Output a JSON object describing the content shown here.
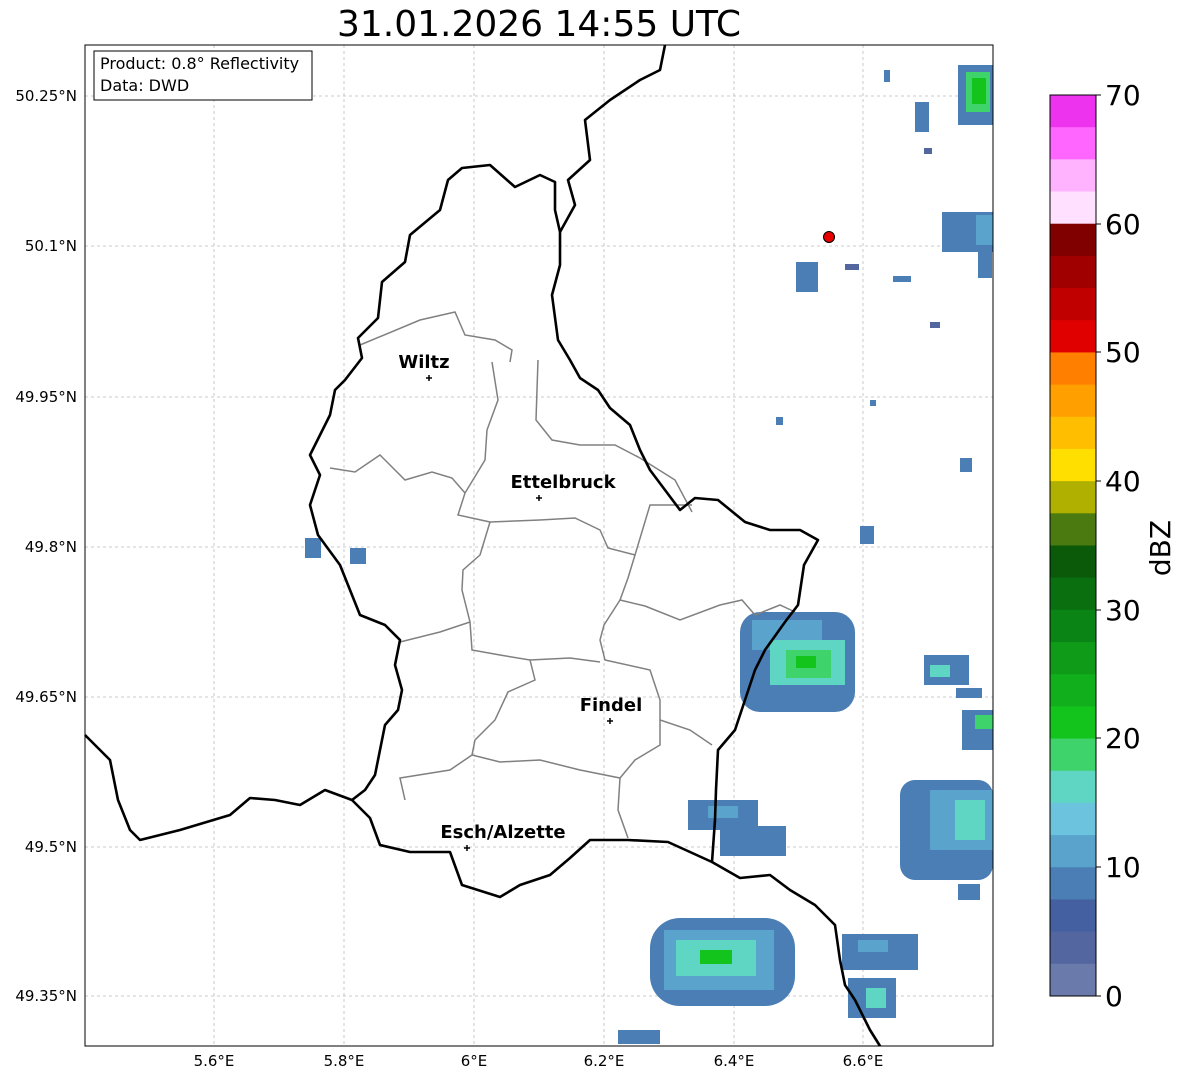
{
  "title": "31.01.2026 14:55 UTC",
  "info_box": {
    "product": "Product: 0.8° Reflectivity",
    "data_source": "Data: DWD"
  },
  "axes": {
    "lat_labels": [
      "50.25°N",
      "50.1°N",
      "49.95°N",
      "49.8°N",
      "49.65°N",
      "49.5°N",
      "49.35°N"
    ],
    "lon_labels": [
      "5.6°E",
      "5.8°E",
      "6°E",
      "6.2°E",
      "6.4°E",
      "6.6°E"
    ]
  },
  "cities": [
    {
      "name": "Wiltz"
    },
    {
      "name": "Ettelbruck"
    },
    {
      "name": "Findel"
    },
    {
      "name": "Esch/Alzette"
    }
  ],
  "radar_site": {
    "lon": 6.548,
    "lat": 50.11,
    "color": "#e60000"
  },
  "colorbar": {
    "label": "dBZ",
    "ticks": [
      "70",
      "60",
      "50",
      "40",
      "30",
      "20",
      "10",
      "0"
    ],
    "colors": [
      "#ee33ee",
      "#ff66ff",
      "#ffb3ff",
      "#ffe0ff",
      "#800000",
      "#a00000",
      "#c00000",
      "#e00000",
      "#ff7f00",
      "#ff9f00",
      "#ffbf00",
      "#ffdf00",
      "#b0b000",
      "#4a7a10",
      "#0a5a0a",
      "#0a700f",
      "#0a8515",
      "#0f9a18",
      "#10af1b",
      "#12c41c",
      "#3fd46b",
      "#5fd6c3",
      "#6bc3dd",
      "#5aa3cc",
      "#4a7eb4",
      "#4460a0",
      "#5466a0",
      "#6a7aaa"
    ]
  }
}
